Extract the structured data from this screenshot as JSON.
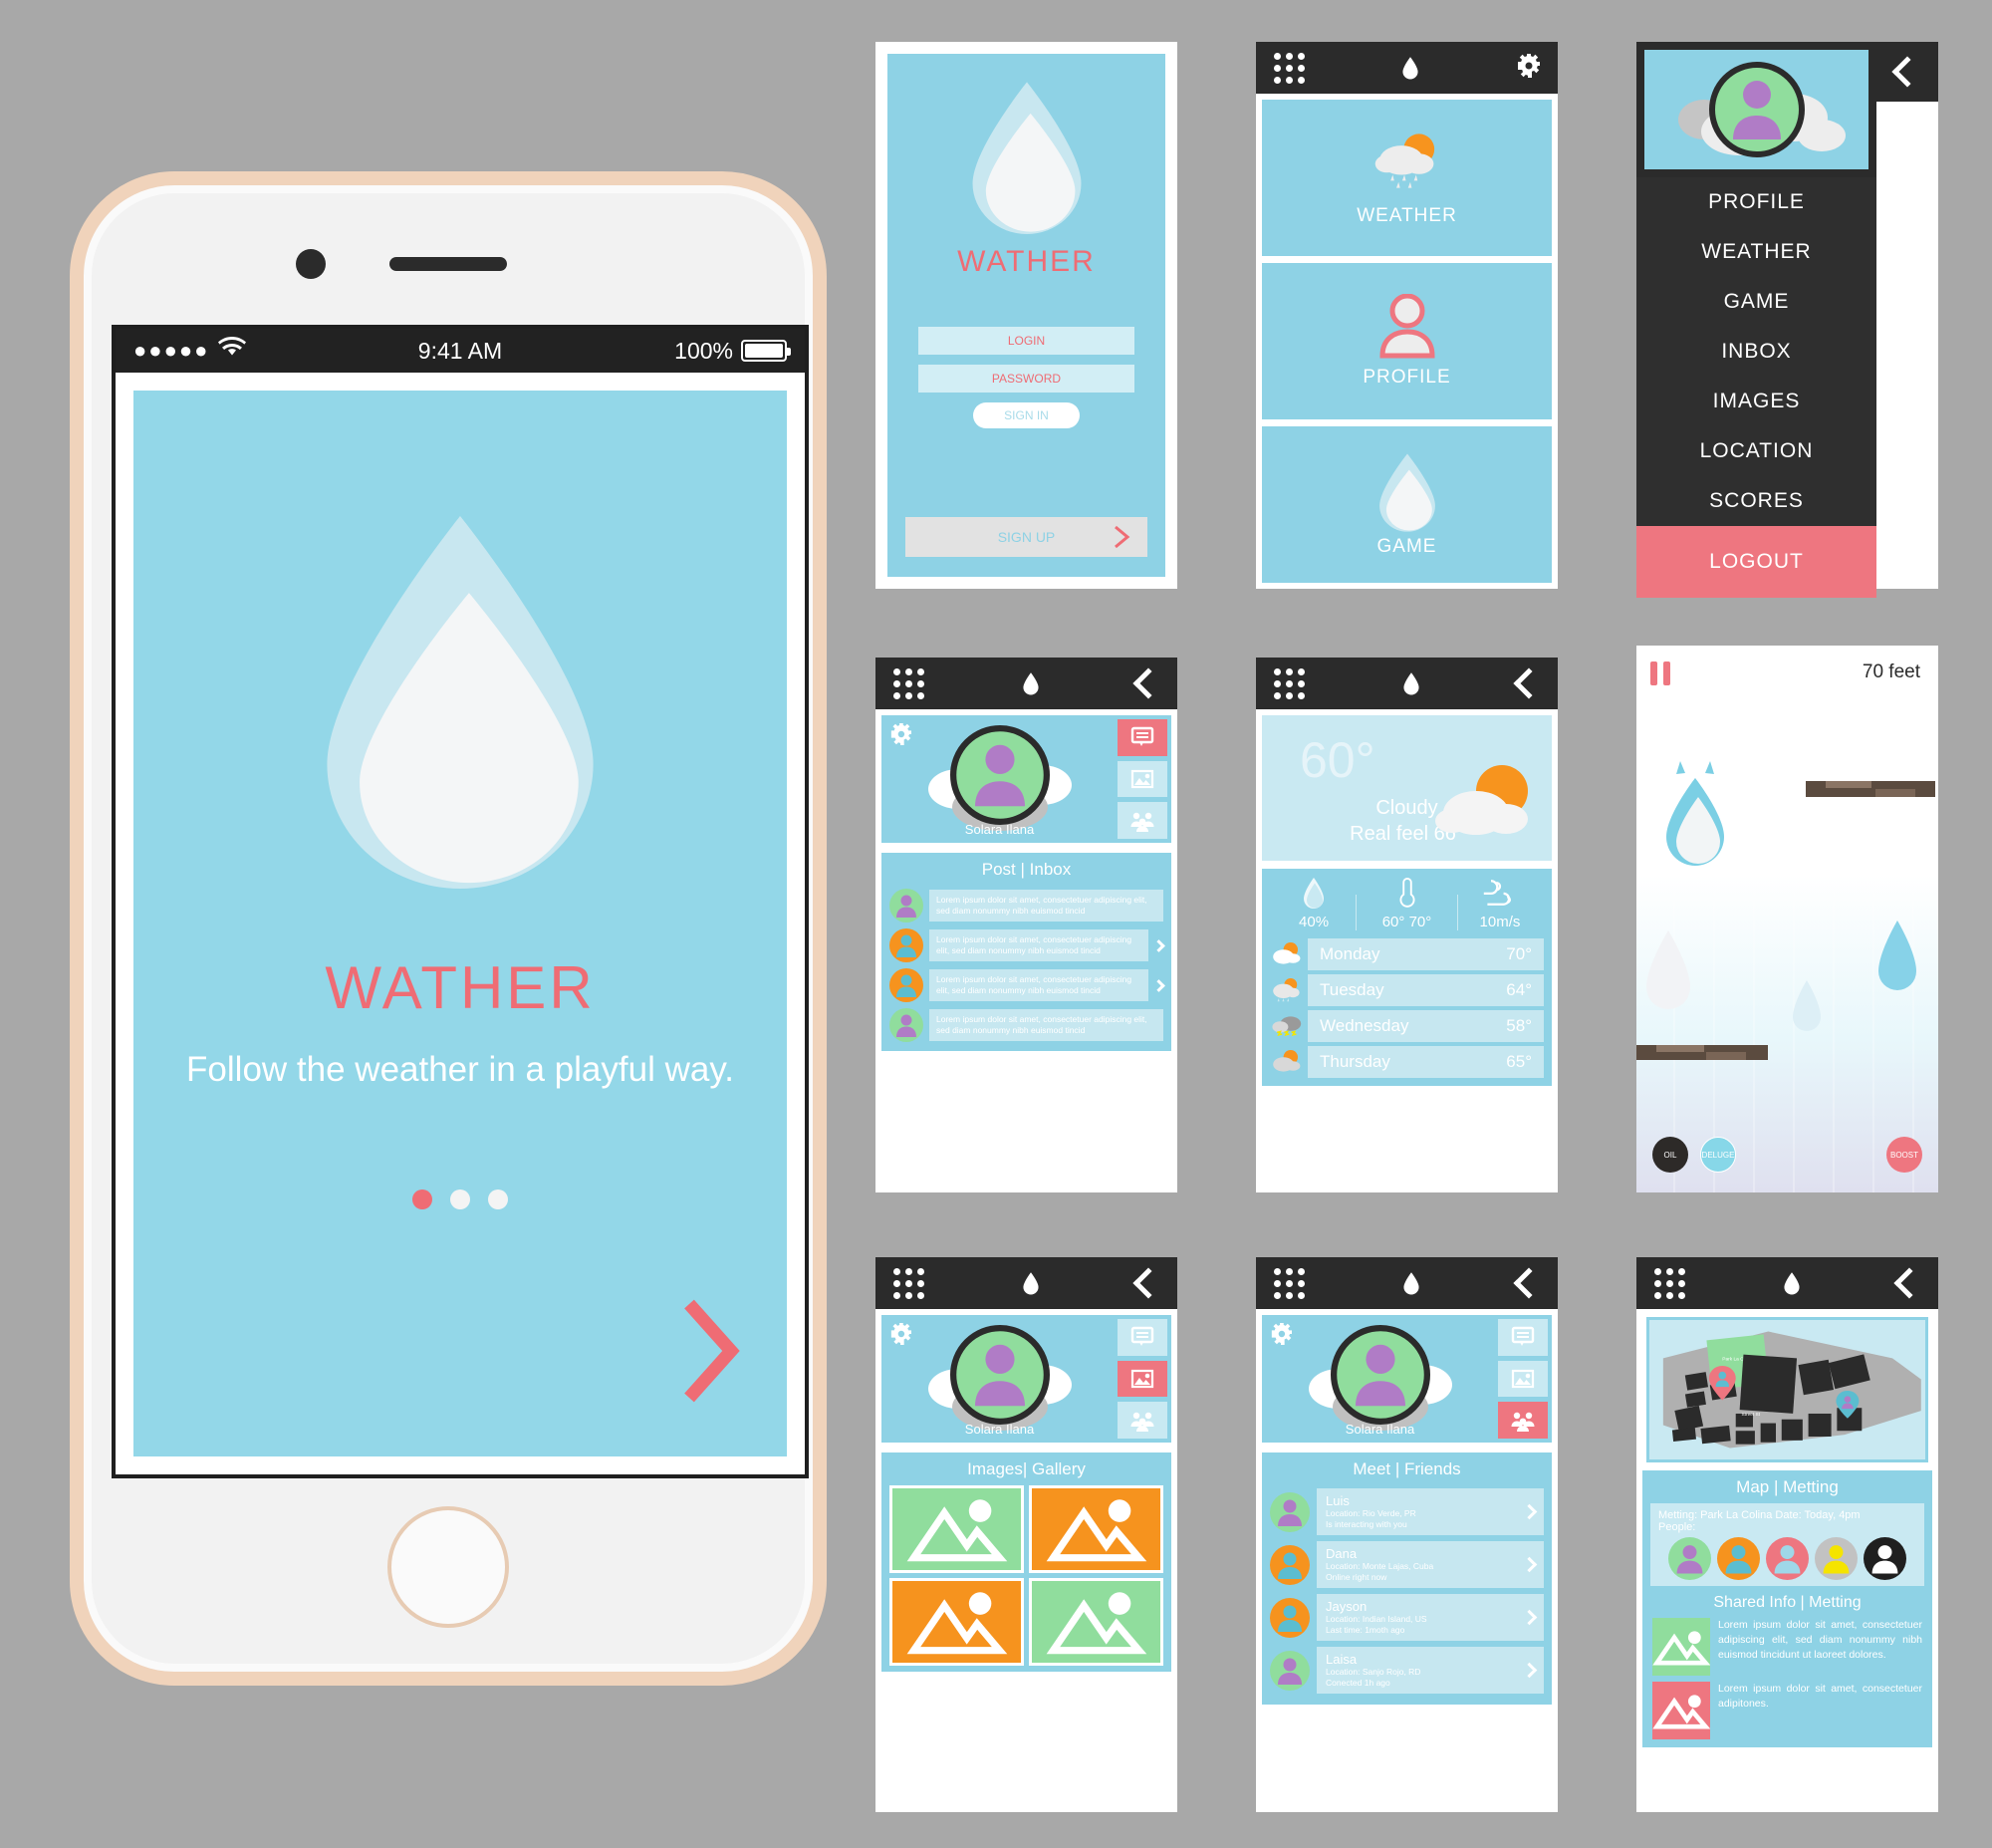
{
  "brand": {
    "name": "WATHER",
    "accent": "#ef6c74",
    "primary": "#8ed2e5",
    "dark": "#2b2b2b"
  },
  "phone": {
    "statusbar": {
      "signal": "●●●●●",
      "wifi": "wifi-icon",
      "time": "9:41 AM",
      "battery_pct": "100%"
    },
    "intro": {
      "title": "WATHER",
      "subtitle": "Follow the weather in a playful way.",
      "dots": 3,
      "active_dot": 1,
      "next_label": "next-arrow"
    }
  },
  "login_screen": {
    "title": "WATHER",
    "login_placeholder": "LOGIN",
    "password_placeholder": "PASSWORD",
    "signin_label": "SIGN IN",
    "signup_label": "SIGN UP"
  },
  "home_screen": {
    "topbar": {
      "menu": "grid-menu-icon",
      "logo": "water-drop-icon",
      "settings": "gear-icon"
    },
    "tiles": [
      {
        "label": "WEATHER",
        "icon": "sun-cloud-rain-icon"
      },
      {
        "label": "PROFILE",
        "icon": "person-icon"
      },
      {
        "label": "GAME",
        "icon": "water-drop-icon"
      }
    ]
  },
  "drawer_screen": {
    "back": "back-chevron-icon",
    "items": [
      "PROFILE",
      "WEATHER",
      "GAME",
      "INBOX",
      "IMAGES",
      "LOCATION",
      "SCORES"
    ],
    "logout_label": "LOGOUT"
  },
  "inbox_screen": {
    "profile": {
      "name": "Solara Ilana"
    },
    "side_buttons": [
      "message-icon",
      "image-icon",
      "people-icon"
    ],
    "active_side_button": 0,
    "panel_title": "Post | Inbox",
    "messages": [
      {
        "avatar_color": "#90dd9d",
        "text": "Lorem ipsum dolor sit amet, consectetuer adipiscing elit, sed diam nonummy nibh euismod tincid",
        "has_arrow": false
      },
      {
        "avatar_color": "#f6931e",
        "text": "Lorem ipsum dolor sit amet, consectetuer adipiscing elit, sed diam nonummy nibh euismod tincid",
        "has_arrow": true
      },
      {
        "avatar_color": "#f6931e",
        "text": "Lorem ipsum dolor sit amet, consectetuer adipiscing elit, sed diam nonummy nibh euismod tincid",
        "has_arrow": true
      },
      {
        "avatar_color": "#90dd9d",
        "text": "Lorem ipsum dolor sit amet, consectetuer adipiscing elit, sed diam nonummy nibh euismod tincid",
        "has_arrow": false
      }
    ]
  },
  "weather_screen": {
    "current": {
      "temp": "60°",
      "condition": "Cloudy",
      "real_feel": "Real feel 66°",
      "icon": "sun-cloud-icon"
    },
    "metrics": [
      {
        "icon": "humidity-drop-icon",
        "value": "40%"
      },
      {
        "icon": "thermometer-icon",
        "value": "60° 70°"
      },
      {
        "icon": "wind-icon",
        "value": "10m/s"
      }
    ],
    "forecast": [
      {
        "day": "Monday",
        "temp": "70°",
        "icon": "sun-cloud-icon"
      },
      {
        "day": "Tuesday",
        "temp": "64°",
        "icon": "sun-cloud-rain-icon"
      },
      {
        "day": "Wednesday",
        "temp": "58°",
        "icon": "thunder-cloud-icon"
      },
      {
        "day": "Thursday",
        "temp": "65°",
        "icon": "sun-cloud-icon"
      }
    ]
  },
  "game_screen": {
    "pause_label": "pause-icon",
    "distance": "70 feet",
    "buttons": [
      {
        "label": "OIL",
        "color": "#2d2a28"
      },
      {
        "label": "DELUGE",
        "color": "#87d7e8"
      },
      {
        "label": "BOOST",
        "color": "#ee7680"
      }
    ]
  },
  "gallery_screen": {
    "profile": {
      "name": "Solara Ilana"
    },
    "side_buttons": [
      "message-icon",
      "image-icon",
      "people-icon"
    ],
    "active_side_button": 1,
    "panel_title": "Images| Gallery",
    "tiles": [
      "#90dd9d",
      "#f6931e",
      "#f6931e",
      "#90dd9d"
    ]
  },
  "friends_screen": {
    "profile": {
      "name": "Solara Ilana"
    },
    "side_buttons": [
      "message-icon",
      "image-icon",
      "people-icon"
    ],
    "active_side_button": 2,
    "panel_title": "Meet | Friends",
    "friends": [
      {
        "name": "Luis",
        "location": "Location: Rio Verde, PR",
        "status": "Is interacting with you",
        "avatar_color": "#90dd9d"
      },
      {
        "name": "Dana",
        "location": "Location: Monte Lajas, Cuba",
        "status": "Online right now",
        "avatar_color": "#f6931e"
      },
      {
        "name": "Jayson",
        "location": "Location: Indian Island, US",
        "status": "Last time: 1moth ago",
        "avatar_color": "#f6931e"
      },
      {
        "name": "Laisa",
        "location": "Location: Sanjo Rojo, RD",
        "status": "Conected 1h ago",
        "avatar_color": "#90dd9d"
      }
    ]
  },
  "map_screen": {
    "map_labels": {
      "park": "Park La Colina",
      "street": "Street St"
    },
    "panel_title": "Map | Metting",
    "meeting_line": "Metting: Park La Colina    Date: Today, 4pm",
    "people_label": "People:",
    "people_colors": [
      "#90dd9d",
      "#f6931e",
      "#ee7680",
      "#c2c2c2",
      "#1f1f1f"
    ],
    "shared_title": "Shared Info | Metting",
    "shared_items": [
      {
        "thumb_color": "#90dd9d",
        "text": "Lorem ipsum dolor sit amet, consectetuer adipiscing elit, sed diam nonummy nibh euismod tincidunt ut laoreet dolores."
      },
      {
        "thumb_color": "#ee7680",
        "text": "Lorem ipsum dolor sit amet, consectetuer adipitones."
      }
    ]
  }
}
